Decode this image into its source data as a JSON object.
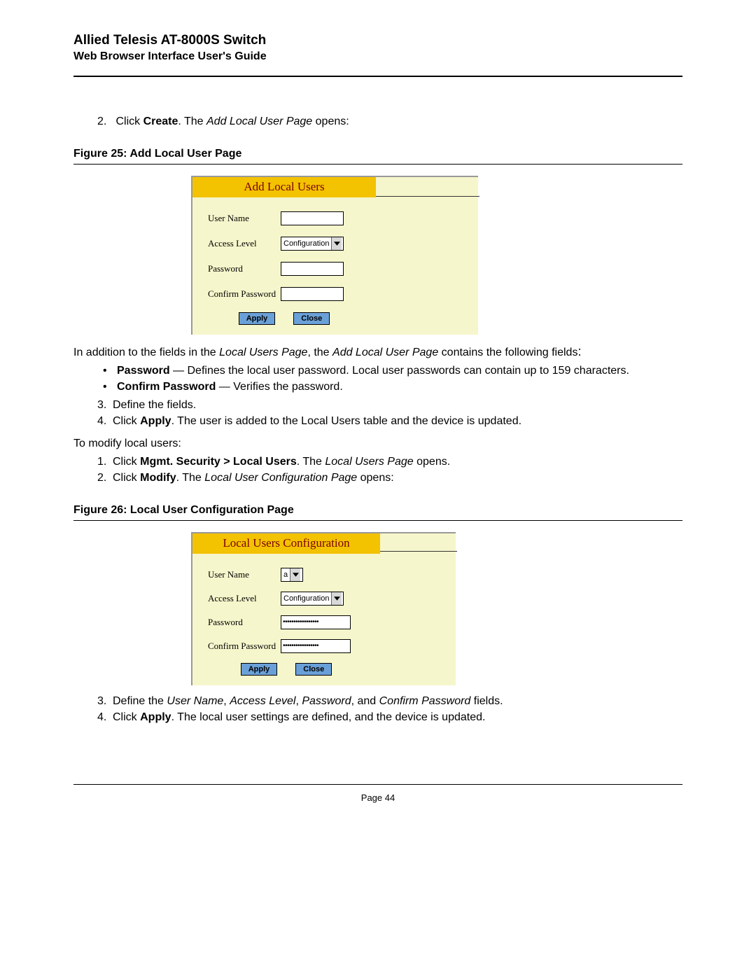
{
  "header": {
    "title": "Allied Telesis AT-8000S Switch",
    "subtitle": "Web Browser Interface User's Guide"
  },
  "step2": {
    "num": "2.",
    "pre": "Click ",
    "bold": "Create",
    "post": ". The ",
    "ital": "Add Local User Page",
    "tail": " opens:"
  },
  "fig25": {
    "caption": "Figure 25:  Add Local User Page",
    "cardTitle": "Add Local Users",
    "rows": {
      "userName": "User Name",
      "accessLevel": "Access Level",
      "password": "Password",
      "confirm": "Confirm Password"
    },
    "accessSel": "Configuration",
    "apply": "Apply",
    "close": "Close"
  },
  "afterFig25": {
    "intro_pre": "In addition to the fields in the ",
    "intro_i1": "Local Users Page",
    "intro_mid": ", the ",
    "intro_i2": "Add Local User Page",
    "intro_post": " contains the following fields",
    "intro_colon": ":",
    "b1_bold": "Password",
    "b1_text": " — Defines the local user password. Local user passwords can contain up to 159 characters.",
    "b2_bold": "Confirm Password",
    "b2_text": " — Verifies the password.",
    "s3_num": "3.",
    "s3_text": "Define the fields.",
    "s4_num": "4.",
    "s4_pre": "Click ",
    "s4_bold": "Apply",
    "s4_post": ". The user is added to the Local Users table and the device is updated."
  },
  "modify": {
    "intro": "To modify local users:",
    "s1_num": "1.",
    "s1_pre": "Click ",
    "s1_bold": "Mgmt. Security > Local Users",
    "s1_mid": ". The ",
    "s1_ital": "Local Users Page",
    "s1_post": " opens.",
    "s2_num": "2.",
    "s2_pre": "Click ",
    "s2_bold": "Modify",
    "s2_mid": ". The ",
    "s2_ital": "Local User Configuration Page",
    "s2_post": " opens:"
  },
  "fig26": {
    "caption": "Figure 26:  Local User Configuration Page",
    "cardTitle": "Local Users Configuration",
    "rows": {
      "userName": "User Name",
      "accessLevel": "Access Level",
      "password": "Password",
      "confirm": "Confirm Password"
    },
    "userSel": "a",
    "accessSel": "Configuration",
    "pwdValue": "•••••••••••••••••",
    "apply": "Apply",
    "close": "Close"
  },
  "afterFig26": {
    "s3_num": "3.",
    "s3_pre": "Define the ",
    "s3_i1": "User Name",
    "s3_c1": ", ",
    "s3_i2": "Access Level",
    "s3_c2": ", ",
    "s3_i3": "Password",
    "s3_c3": ", and ",
    "s3_i4": "Confirm Password",
    "s3_post": " fields.",
    "s4_num": "4.",
    "s4_pre": "Click ",
    "s4_bold": "Apply",
    "s4_post": ". The local user settings are defined, and the device is updated."
  },
  "footer": "Page 44"
}
